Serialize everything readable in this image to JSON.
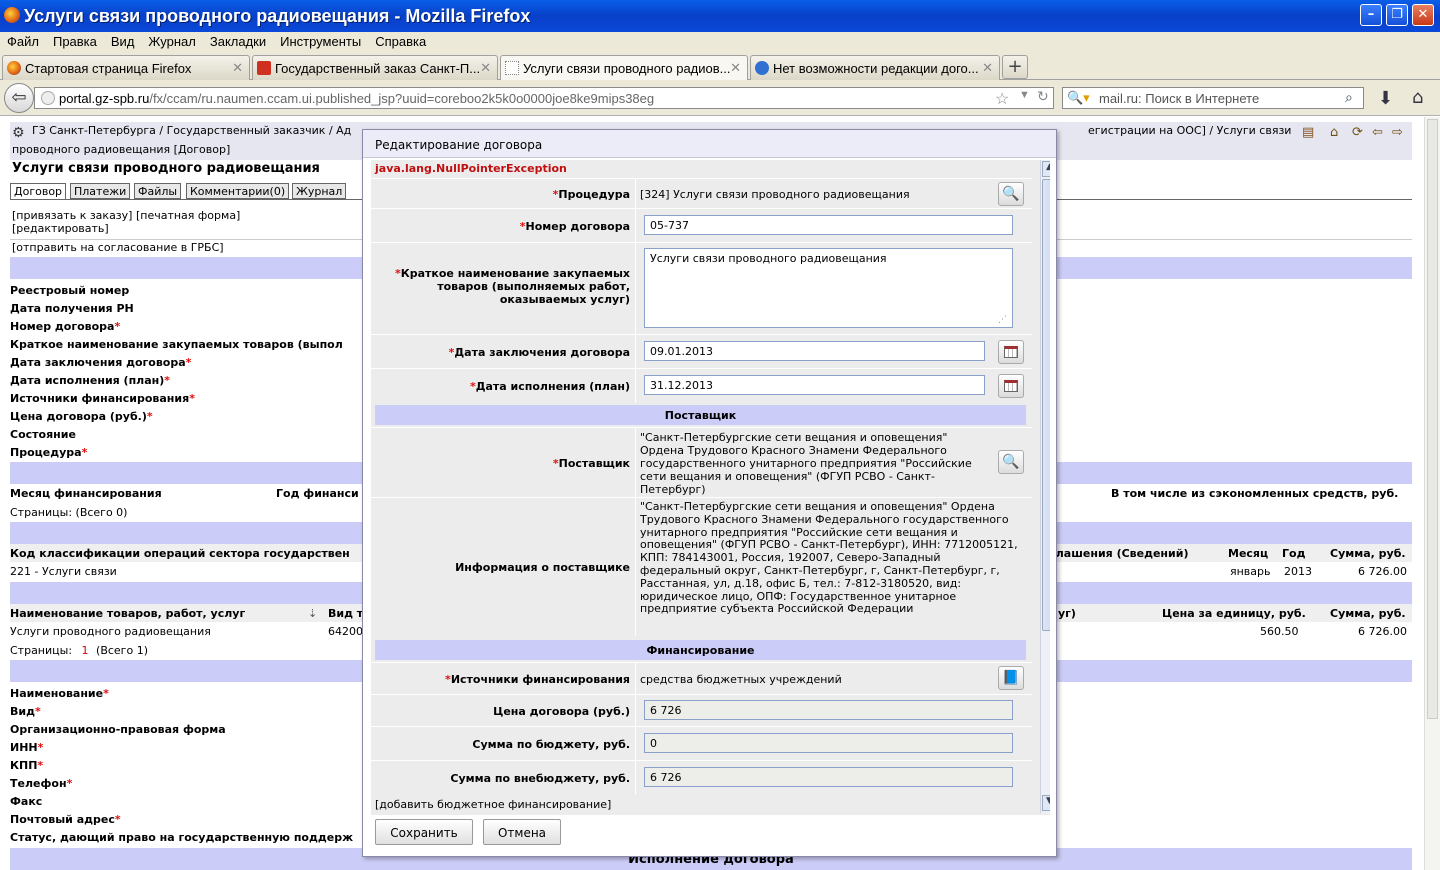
{
  "window": {
    "title": "Услуги связи проводного радиовещания - Mozilla Firefox"
  },
  "menu": [
    "Файл",
    "Правка",
    "Вид",
    "Журнал",
    "Закладки",
    "Инструменты",
    "Справка"
  ],
  "tabs": [
    {
      "label": "Стартовая страница Firefox"
    },
    {
      "label": "Государственный заказ Санкт-П..."
    },
    {
      "label": "Услуги связи проводного радиов..."
    },
    {
      "label": "Нет возможности редакции дого..."
    }
  ],
  "nav": {
    "url_domain": "portal.gz-spb.ru",
    "url_path": "/fx/ccam/ru.naumen.ccam.ui.published_jsp?uuid=coreboo2k5k0o0000joe8ke9mips38eg",
    "search_placeholder": "mail.ru: Поиск в Интернете"
  },
  "page": {
    "breadcrumb_left": "ГЗ Санкт-Петербурга / Государственный заказчик / Ад",
    "breadcrumb_right": "егистрации на ООС] / Услуги связи",
    "breadcrumb_line2": "проводного радиовещания [Договор]",
    "title": "Услуги связи проводного радиовещания",
    "tabs": [
      "Договор",
      "Платежи",
      "Файлы",
      "Комментарии(0)",
      "Журнал"
    ],
    "actions1": "[привязать к заказу] [печатная форма]",
    "actions2": "[редактировать]",
    "actions3": "[отправить на согласование в ГРБС]",
    "fields": [
      {
        "label": "Реестровый номер",
        "req": ""
      },
      {
        "label": "Дата получения РН",
        "req": ""
      },
      {
        "label": "Номер договора",
        "req": "*"
      },
      {
        "label": "Краткое наименование закупаемых товаров (выпол",
        "req": ""
      },
      {
        "label": "Дата заключения договора",
        "req": "*"
      },
      {
        "label": "Дата исполнения (план)",
        "req": "*"
      },
      {
        "label": "Источники финансирования",
        "req": "*"
      },
      {
        "label": "Цена договора (руб.)",
        "req": "*"
      },
      {
        "label": "Состояние",
        "req": ""
      },
      {
        "label": "Процедура",
        "req": "*"
      }
    ],
    "fin_header": {
      "c1": "Месяц финансирования",
      "c2": "Год финанси",
      "c3": "В том числе из сэкономленных средств, руб."
    },
    "pages_0": "Страницы:  (Всего 0)",
    "kosgu_header": {
      "c1": "Код классификации операций сектора государствен",
      "c2": "глашения (Сведений)",
      "c3": "Месяц",
      "c4": "Год",
      "c5": "Сумма, руб."
    },
    "kosgu_row": {
      "c1": "221 - Услуги связи",
      "c3": "январь",
      "c4": "2013",
      "c5": "6 726.00"
    },
    "goods_header": {
      "c1": "Наименование товаров, работ, услуг",
      "c2": "Вид т",
      "c3": "уг)",
      "c4": "Цена за единицу, руб.",
      "c5": "Сумма, руб."
    },
    "goods_row": {
      "c1": "Услуги проводного радиовещания",
      "c2": "64200",
      "c4": "560.50",
      "c5": "6 726.00"
    },
    "pages_1_label": "Страницы:",
    "pages_1_num": "1",
    "pages_1_total": "(Всего 1)",
    "supplier_fields": [
      {
        "label": "Наименование",
        "req": "*"
      },
      {
        "label": "Вид",
        "req": "*"
      },
      {
        "label": "Организационно-правовая форма",
        "req": ""
      },
      {
        "label": "ИНН",
        "req": "*"
      },
      {
        "label": "КПП",
        "req": "*"
      },
      {
        "label": "Телефон",
        "req": "*"
      },
      {
        "label": "Факс",
        "req": ""
      },
      {
        "label": "Почтовый адрес",
        "req": "*"
      },
      {
        "label": "Статус, дающий право на государственную поддерж",
        "req": ""
      }
    ],
    "bottom_band": "Исполнение договора"
  },
  "modal": {
    "title": "Редактирование договора",
    "error": "java.lang.NullPointerException",
    "procedure_label": "Процедура",
    "procedure_value": "[324] Услуги связи проводного радиовещания",
    "number_label": "Номер договора",
    "number_value": "05-737",
    "short_name_label": "Краткое наименование закупаемых товаров (выполняемых работ, оказываемых услуг)",
    "short_name_value": "Услуги связи проводного радиовещания",
    "date_concl_label": "Дата заключения договора",
    "date_concl_value": "09.01.2013",
    "date_exec_label": "Дата исполнения (план)",
    "date_exec_value": "31.12.2013",
    "supplier_section": "Поставщик",
    "supplier_label": "Поставщик",
    "supplier_value": "\"Санкт-Петербургские сети вещания и оповещения\" Ордена Трудового Красного Знамени Федерального государственного унитарного предприятия \"Российские сети вещания и оповещения\" (ФГУП РСВО - Санкт-Петербург)",
    "supplier_info_label": "Информация о поставщике",
    "supplier_info_value": "\"Санкт-Петербургские сети вещания и оповещения\" Ордена Трудового Красного Знамени Федерального государственного унитарного предприятия \"Российские сети вещания и оповещения\" (ФГУП РСВО - Санкт-Петербург), ИНН: 7712005121, КПП: 784143001, Россия, 192007, Северо-Западный федеральный округ, Санкт-Петербург, г, Санкт-Петербург, г, Расстанная, ул, д.18, офис Б, тел.: 7-812-3180520, вид: юридическое лицо, ОПФ: Государственное унитарное предприятие субъекта Российской Федерации",
    "finance_section": "Финансирование",
    "sources_label": "Источники финансирования",
    "sources_value": "средства бюджетных учреждений",
    "price_label": "Цена договора (руб.)",
    "price_value": "6 726",
    "budget_label": "Сумма по бюджету, руб.",
    "budget_value": "0",
    "offbudget_label": "Сумма по внебюджету, руб.",
    "offbudget_value": "6 726",
    "add_budget_link": "[добавить бюджетное финансирование]",
    "save_label": "Сохранить",
    "cancel_label": "Отмена",
    "req_mark": "*"
  }
}
